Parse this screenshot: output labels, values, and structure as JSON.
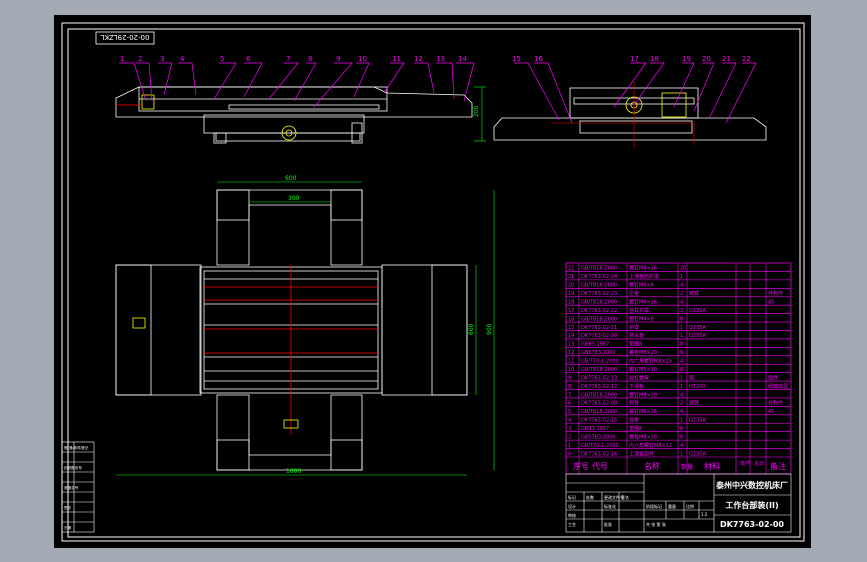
{
  "drawing_number_top": "00-20-29LZKL",
  "drawing_number_main": "DK7763-02-00",
  "company": "泰州中兴数控机床厂",
  "assembly_title": "工作台部装(II)",
  "balloons_front": [
    "1",
    "2",
    "3",
    "4",
    "5",
    "6",
    "7",
    "8",
    "9",
    "10",
    "11",
    "12",
    "13",
    "14"
  ],
  "balloons_side": [
    "15",
    "16",
    "17",
    "18",
    "19",
    "20",
    "21",
    "22"
  ],
  "bom_header": {
    "item": "序号",
    "code": "代号",
    "name": "名称",
    "qty": "数量",
    "material": "材料",
    "unit_weight": "单件",
    "total_weight": "总计",
    "remark": "备注"
  },
  "bom_rows": [
    {
      "no": "22",
      "code": "GB/T818-2000",
      "name": "螺钉M8×16",
      "qty": "20",
      "mat": "",
      "rem": ""
    },
    {
      "no": "21",
      "code": "DK7763-02-24",
      "name": "上滑板防护罩",
      "qty": "1",
      "mat": "",
      "rem": ""
    },
    {
      "no": "20",
      "code": "GB/T818-2000",
      "name": "螺钉M6×8",
      "qty": "4",
      "mat": "",
      "rem": ""
    },
    {
      "no": "19",
      "code": "DK7763-02-23",
      "name": "压板",
      "qty": "2",
      "mat": "铸铁",
      "rem": "外购件"
    },
    {
      "no": "18",
      "code": "GB/T818-2000",
      "name": "螺钉M6×16",
      "qty": "4",
      "mat": "",
      "rem": "45"
    },
    {
      "no": "17",
      "code": "DK7763-02-22",
      "name": "丝杠护罩",
      "qty": "2",
      "mat": "Q235A",
      "rem": ""
    },
    {
      "no": "16",
      "code": "GB/T818-2000",
      "name": "螺钉M4×8",
      "qty": "8",
      "mat": "",
      "rem": ""
    },
    {
      "no": "15",
      "code": "DK7763-02-21",
      "name": "护罩",
      "qty": "1",
      "mat": "Q235A",
      "rem": ""
    },
    {
      "no": "14",
      "code": "DK7763-02-20",
      "name": "挡水板",
      "qty": "1",
      "mat": "Q235A",
      "rem": ""
    },
    {
      "no": "13",
      "code": "GB93-1987",
      "name": "垫圈8",
      "qty": "8",
      "mat": "",
      "rem": ""
    },
    {
      "no": "12",
      "code": "GB5783-2000",
      "name": "螺栓M8×20",
      "qty": "8",
      "mat": "",
      "rem": ""
    },
    {
      "no": "11",
      "code": "GB/T70.1-2000",
      "name": "内六角螺钉M8×25",
      "qty": "4",
      "mat": "",
      "rem": ""
    },
    {
      "no": "10",
      "code": "GB/T818-2000",
      "name": "螺钉M5×10",
      "qty": "8",
      "mat": "",
      "rem": ""
    },
    {
      "no": "9",
      "code": "DK7763-02-13",
      "name": "丝杠螺母",
      "qty": "1",
      "mat": "铜",
      "rem": "组件"
    },
    {
      "no": "8",
      "code": "DK7763-02-12",
      "name": "下滑板",
      "qty": "1",
      "mat": "HT200",
      "rem": "组装成品"
    },
    {
      "no": "7",
      "code": "GB/T818-2000",
      "name": "螺钉M8×20",
      "qty": "4",
      "mat": "",
      "rem": ""
    },
    {
      "no": "6",
      "code": "DK7763-02-08",
      "name": "斜铁",
      "qty": "2",
      "mat": "铸铁",
      "rem": "外购件"
    },
    {
      "no": "5",
      "code": "GB/T818-2000",
      "name": "螺钉M6×16",
      "qty": "4",
      "mat": "",
      "rem": "45"
    },
    {
      "no": "4",
      "code": "DK7763-02-15",
      "name": "挡板",
      "qty": "1",
      "mat": "Q235A",
      "rem": ""
    },
    {
      "no": "3",
      "code": "GB93-1987",
      "name": "垫圈8",
      "qty": "8",
      "mat": "",
      "rem": ""
    },
    {
      "no": "2",
      "code": "GB5783-2000",
      "name": "螺栓M8×20",
      "qty": "8",
      "mat": "",
      "rem": ""
    },
    {
      "no": "1",
      "code": "GB/T70.1-2000",
      "name": "内六角螺钉M8×12",
      "qty": "4",
      "mat": "",
      "rem": ""
    },
    {
      "no": "0",
      "code": "DK7763-02-16",
      "name": "上滑板部件",
      "qty": "1",
      "mat": "Q235A",
      "rem": ""
    }
  ],
  "title_block": {
    "marks": "标记",
    "count": "处数",
    "zone": "分区",
    "change_doc": "更改文件号",
    "signature": "签名",
    "date": "年月日",
    "designer": "设计",
    "standardization": "标准化",
    "stage_mark": "阶段标记",
    "weight": "重量",
    "scale": "比例",
    "scale_value": "1:2",
    "checker": "审核",
    "process": "工艺",
    "approve": "批准",
    "sheets": "共 张 第 张"
  },
  "side_stamp": [
    "借(通)用件登记",
    "",
    "旧底图总号",
    "",
    "底图总号",
    "",
    "签字",
    "",
    "日期"
  ],
  "dims": {
    "top_width": "600",
    "inner": "300",
    "outer_width": "1000",
    "height_right": "900",
    "height_inner": "600",
    "front_height": "200"
  }
}
